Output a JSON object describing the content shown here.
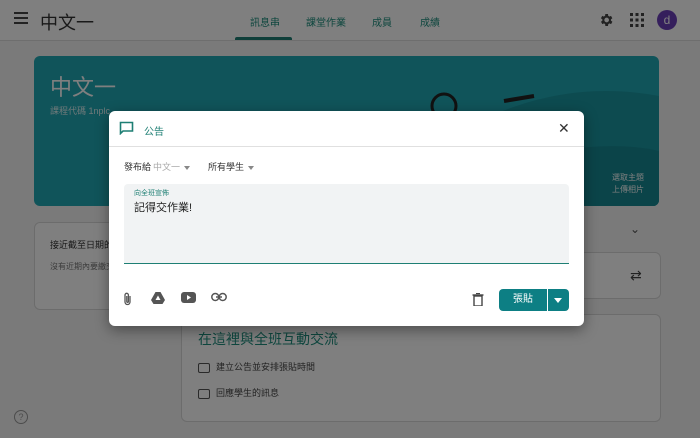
{
  "app": {
    "title": "中文一",
    "avatar_letter": "d"
  },
  "nav": {
    "tabs": [
      "訊息串",
      "課堂作業",
      "成員",
      "成績"
    ],
    "active_tab_index": 0
  },
  "banner": {
    "class_name": "中文一",
    "class_code_label": "課程代碼  1nplc",
    "select_theme": "選取主題",
    "upload_photo": "上傳相片"
  },
  "left_card": {
    "title": "接近截至日期的",
    "subtitle": "沒有近期內要繳交"
  },
  "info_card": {
    "title": "在這裡與全班互動交流",
    "items": [
      "建立公告並安排張貼時間",
      "回應學生的訊息"
    ]
  },
  "dialog": {
    "title": "公告",
    "post_to_label": "發布給",
    "class_select": "中文一",
    "students_select": "所有學生",
    "textarea_label": "向全班宣佈",
    "textarea_value": "記得交作業!",
    "post_button": "張貼"
  },
  "colors": {
    "accent": "#1e7f74",
    "banner": "#20a8b4",
    "post_button": "#0d7f84",
    "avatar": "#6a3fb8"
  }
}
